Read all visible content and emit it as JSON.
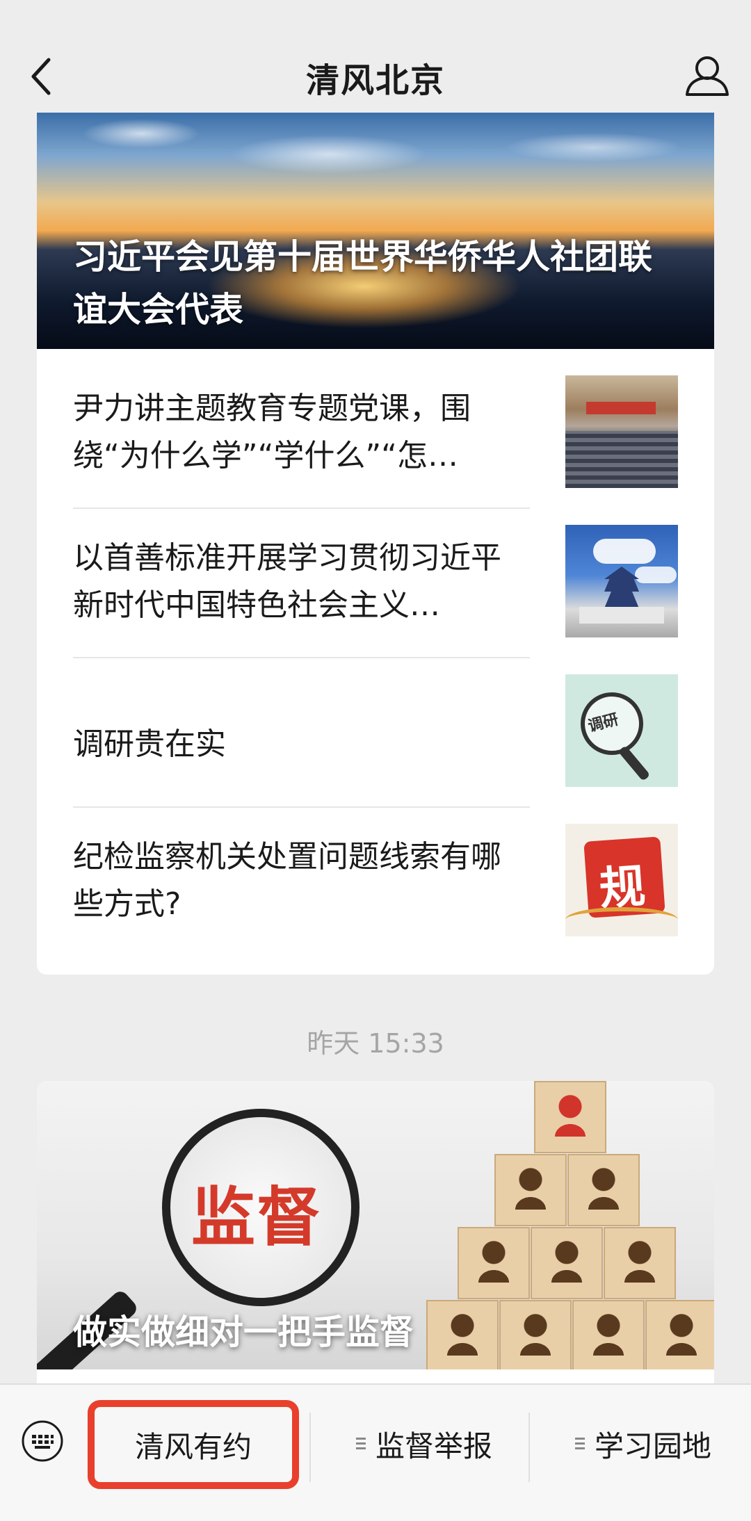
{
  "header": {
    "title": "清风北京",
    "back_icon": "chevron-left-icon",
    "profile_icon": "person-icon"
  },
  "card1": {
    "hero_caption": "习近平会见第十届世界华侨华人社团联谊大会代表",
    "items": [
      {
        "title": "尹力讲主题教育专题党课，围绕“为什么学”“学什么”“怎…"
      },
      {
        "title": "以首善标准开展学习贯彻习近平新时代中国特色社会主义…"
      },
      {
        "title": "调研贵在实",
        "thumb_text": "调研"
      },
      {
        "title": "纪检监察机关处置问题线索有哪些方式?",
        "thumb_text": "规"
      }
    ]
  },
  "timestamp": "昨天 15:33",
  "card2": {
    "hero_caption": "做实做细对一把手监督",
    "lens_text": "监督"
  },
  "bottom_menu": {
    "keyboard_icon": "keyboard-icon",
    "items": [
      {
        "label": "清风有约"
      },
      {
        "label": "监督举报"
      },
      {
        "label": "学习园地"
      }
    ],
    "highlight_color": "#e8402c"
  }
}
